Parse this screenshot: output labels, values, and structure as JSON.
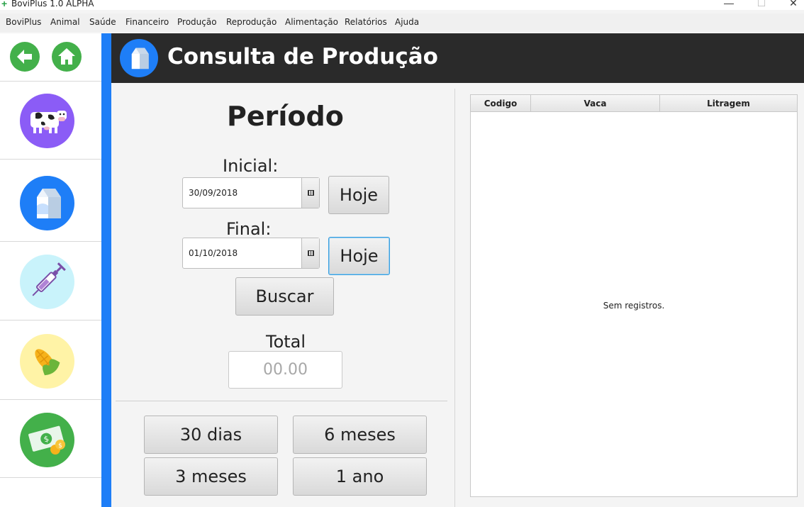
{
  "window": {
    "title": "BoviPlus 1.0 ALPHA",
    "minimize": "—",
    "maximize": "☐",
    "close": "✕"
  },
  "menu": [
    "BoviPlus",
    "Animal",
    "Saúde",
    "Financeiro",
    "Produção",
    "Reprodução",
    "Alimentação",
    "Relatórios",
    "Ajuda"
  ],
  "sidebar": {
    "items": [
      {
        "name": "animal",
        "icon": "cow-icon",
        "color": "#8b5cf6"
      },
      {
        "name": "producao",
        "icon": "milk-carton-icon",
        "color": "#1e7ef7"
      },
      {
        "name": "saude",
        "icon": "syringe-icon",
        "color": "#c9f3fb"
      },
      {
        "name": "alimentacao",
        "icon": "corn-icon",
        "color": "#fff3a6"
      },
      {
        "name": "financeiro",
        "icon": "money-icon",
        "color": "#43b04a"
      }
    ]
  },
  "header": {
    "title": "Consulta de Produção"
  },
  "form": {
    "heading": "Período",
    "initial_label": "Inicial:",
    "initial_date": "30/09/2018",
    "final_label": "Final:",
    "final_date": "01/10/2018",
    "today_label": "Hoje",
    "search_label": "Buscar",
    "total_label": "Total",
    "total_placeholder": "00.00"
  },
  "quick_ranges": [
    "30 dias",
    "6 meses",
    "3 meses",
    "1 ano"
  ],
  "table": {
    "columns": [
      "Codigo",
      "Vaca",
      "Litragem"
    ],
    "empty_message": "Sem registros."
  },
  "colors": {
    "accent": "#1e7ef7",
    "header_bg": "#2a2a2a",
    "nav_green": "#43b04a"
  }
}
